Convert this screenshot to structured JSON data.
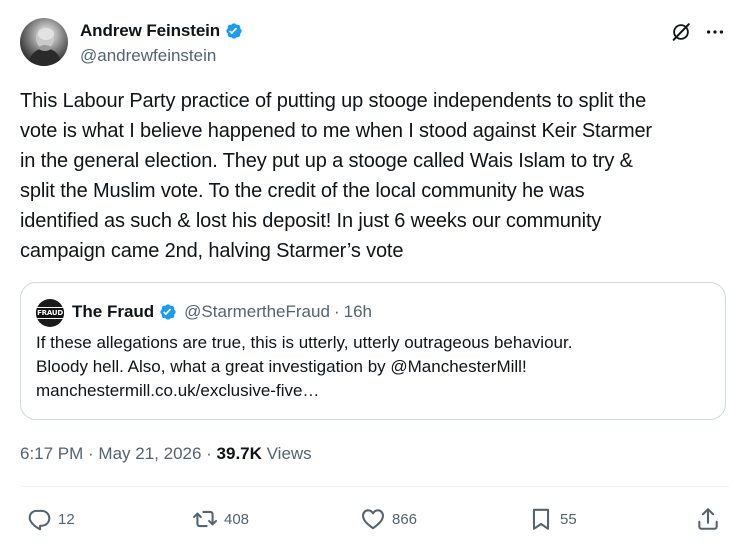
{
  "author": {
    "name": "Andrew Feinstein",
    "handle": "@andrewfeinstein",
    "verified": true
  },
  "icons": {
    "header": [
      "verified-badge-icon",
      "grok-icon",
      "more-options-icon"
    ],
    "actions": [
      "reply-icon",
      "repost-icon",
      "like-icon",
      "bookmark-icon",
      "share-icon"
    ]
  },
  "tweet": {
    "lines": [
      "This Labour Party practice of putting up stooge independents to split the",
      "vote is what I believe happened to me when I stood against Keir Starmer",
      "in the general election. They put up a stooge called Wais Islam to try &",
      "split the Muslim vote. To the credit of the local community he was",
      "identified as such & lost his deposit! In just 6 weeks our community",
      "campaign came 2nd, halving Starmer’s vote"
    ]
  },
  "quote": {
    "avatar_text": "FRAUD",
    "name": "The Fraud",
    "handle": "@StarmertheFraud",
    "separator": "·",
    "time": "16h",
    "lines": [
      "If these allegations are true, this is utterly, utterly outrageous behaviour.",
      "Bloody hell. Also, what a great investigation by @ManchesterMill!",
      "manchestermill.co.uk/exclusive-five…"
    ]
  },
  "meta": {
    "timestamp": "6:17 PM · May 21, 2026 · ",
    "views_count": "39.7K",
    "views_label": " Views"
  },
  "actions": {
    "replies": "12",
    "reposts": "408",
    "likes": "866",
    "bookmarks": "55"
  },
  "colors": {
    "verified": "#1d9bf0",
    "secondary_text": "#536471",
    "primary_text": "#0f1419",
    "border": "#cfd9de"
  }
}
